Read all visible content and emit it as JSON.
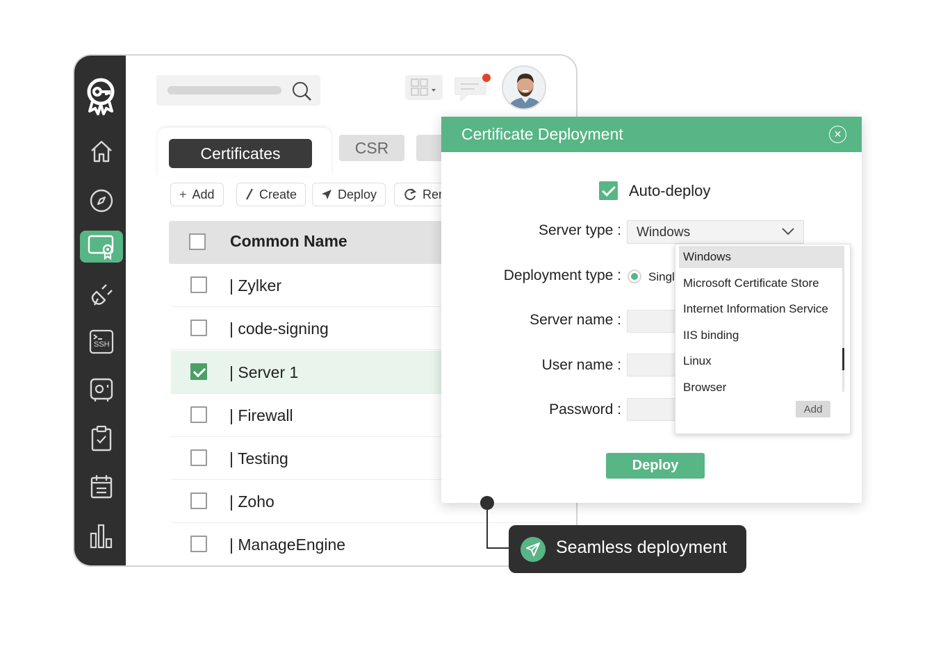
{
  "tabs": {
    "active": "Certificates",
    "second": "CSR"
  },
  "actions": [
    {
      "label": "Add",
      "icon": "plus-icon"
    },
    {
      "label": "Create",
      "icon": "pencil-icon"
    },
    {
      "label": "Deploy",
      "icon": "send-icon"
    },
    {
      "label": "Ren",
      "icon": "renew-icon"
    }
  ],
  "table": {
    "header": "Common Name",
    "rows": [
      {
        "name": "| Zylker",
        "checked": false
      },
      {
        "name": "| code-signing",
        "checked": false
      },
      {
        "name": "| Server 1",
        "checked": true
      },
      {
        "name": "| Firewall",
        "checked": false
      },
      {
        "name": "| Testing",
        "checked": false
      },
      {
        "name": "| Zoho",
        "checked": false
      },
      {
        "name": "| ManageEngine",
        "checked": false
      }
    ]
  },
  "sidebar": {
    "icons": [
      "home-icon",
      "compass-icon",
      "certificate-icon",
      "plug-icon",
      "ssh-terminal-icon",
      "device-icon",
      "clipboard-check-icon",
      "calendar-icon",
      "bar-chart-icon"
    ],
    "ssh_label": "SSH"
  },
  "modal": {
    "title": "Certificate Deployment",
    "auto_deploy_label": "Auto-deploy",
    "server_type_label": "Server type :",
    "server_type_value": "Windows",
    "deployment_type_label": "Deployment type :",
    "deployment_type_option": "Singl",
    "server_name_label": "Server name :",
    "user_name_label": "User name :",
    "password_label": "Password :",
    "deploy_button": "Deploy",
    "dropdown_options": [
      "Windows",
      "Microsoft Certificate Store",
      "Internet Information Service",
      "IIS binding",
      "Linux",
      "Browser"
    ],
    "dropdown_add": "Add"
  },
  "callout": {
    "text": "Seamless deployment"
  },
  "colors": {
    "accent": "#58b585",
    "sidebar": "#2f2f2f",
    "notification": "#e0442f"
  }
}
